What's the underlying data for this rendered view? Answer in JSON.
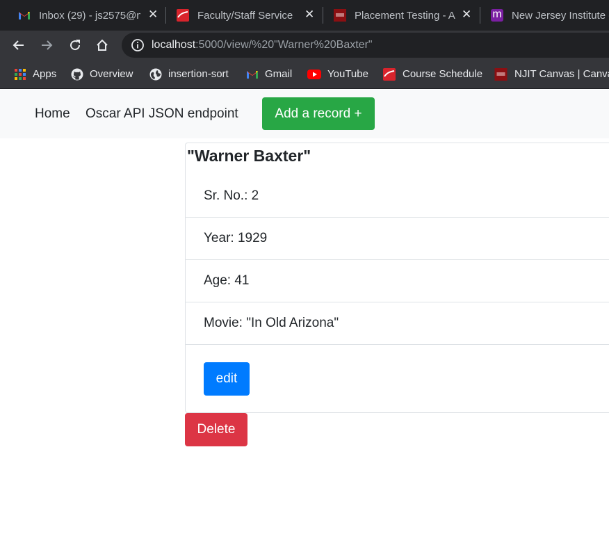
{
  "browser": {
    "tabs": [
      {
        "title": "Inbox (29) - js2575@n",
        "icon": "gmail-icon"
      },
      {
        "title": "Faculty/Staff Services",
        "icon": "njit-red-icon"
      },
      {
        "title": "Placement Testing - A",
        "icon": "njit-seal-icon"
      },
      {
        "title": "New Jersey Institute o",
        "icon": "moodle-m-icon",
        "icon_letter": "m"
      }
    ],
    "close_glyph": "✕",
    "url": {
      "host": "localhost",
      "rest": ":5000/view/%20\"Warner%20Baxter\""
    },
    "bookmarks": [
      {
        "label": "Apps",
        "icon": "apps-grid-icon"
      },
      {
        "label": "Overview",
        "icon": "github-icon"
      },
      {
        "label": "insertion-sort",
        "icon": "globe-icon"
      },
      {
        "label": "Gmail",
        "icon": "gmail-icon"
      },
      {
        "label": "YouTube",
        "icon": "youtube-icon"
      },
      {
        "label": "Course Schedule",
        "icon": "njit-red-icon"
      },
      {
        "label": "NJIT Canvas | Canvas",
        "icon": "njit-seal-icon"
      }
    ]
  },
  "nav": {
    "home": "Home",
    "api": "Oscar API JSON endpoint",
    "add": "Add a record +"
  },
  "record": {
    "title": "\"Warner Baxter\"",
    "fields": [
      "Sr. No.: 2",
      "Year: 1929",
      "Age: 41",
      "Movie: \"In Old Arizona\""
    ],
    "edit": "edit",
    "delete": "Delete"
  },
  "colors": {
    "add_button": "#28a745",
    "edit_button": "#007bff",
    "delete_button": "#dc3545",
    "navbar_bg": "#f8f9fa"
  }
}
